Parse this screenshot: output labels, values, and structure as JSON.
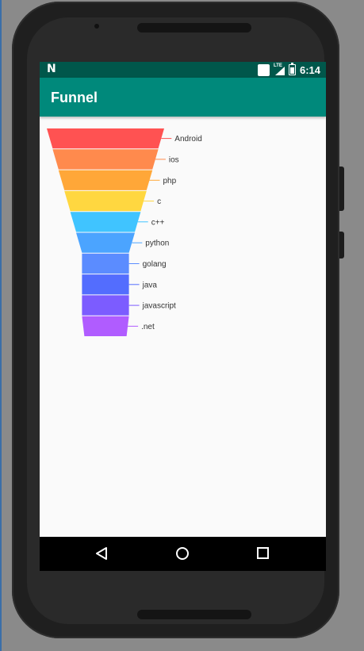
{
  "app": {
    "title": "Funnel"
  },
  "status_bar": {
    "notification_glyph": "N",
    "time": "6:14",
    "network_label": "LTE",
    "icons": [
      "notification-icon",
      "sim-icon",
      "lte-signal-icon",
      "battery-icon"
    ]
  },
  "navigation": {
    "icons": [
      "back-icon",
      "home-icon",
      "recents-icon"
    ]
  },
  "colors": {
    "status_bar": "#00574b",
    "app_bar": "#00897b"
  },
  "chart_data": {
    "type": "funnel",
    "categories": [
      "Android",
      "ios",
      "php",
      "c",
      "c++",
      "python",
      "golang",
      "java",
      "javascript",
      ".net"
    ],
    "colors": [
      "#ff5252",
      "#ff8a4d",
      "#ffa738",
      "#ffd740",
      "#40c4ff",
      "#4ba4ff",
      "#5b8cff",
      "#536dfe",
      "#7c5cff",
      "#b05cff"
    ],
    "values": [
      100,
      90,
      80,
      70,
      60,
      50,
      40,
      40,
      40,
      40
    ]
  }
}
